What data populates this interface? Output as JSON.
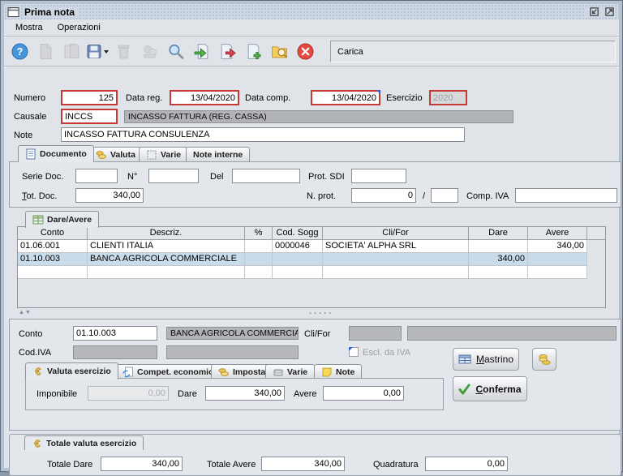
{
  "window": {
    "title": "Prima nota",
    "menu_items": [
      "Mostra",
      "Operazioni"
    ],
    "status_text": "Carica"
  },
  "toolbar_icons": [
    {
      "name": "help-icon",
      "disabled": false
    },
    {
      "name": "edit-icon",
      "disabled": true
    },
    {
      "name": "copy-icon",
      "disabled": true
    },
    {
      "name": "save-icon",
      "disabled": false
    },
    {
      "name": "delete-icon",
      "disabled": true
    },
    {
      "name": "stamp-icon",
      "disabled": true
    },
    {
      "name": "search-icon",
      "disabled": false
    },
    {
      "name": "go-icon",
      "disabled": false
    },
    {
      "name": "export-icon",
      "disabled": false
    },
    {
      "name": "new-document-icon",
      "disabled": false
    },
    {
      "name": "browse-icon",
      "disabled": false
    },
    {
      "name": "close-icon",
      "disabled": false
    }
  ],
  "header_fields": {
    "numero": {
      "label": "Numero",
      "value": "125"
    },
    "data_reg": {
      "label": "Data reg.",
      "value": "13/04/2020"
    },
    "data_comp": {
      "label": "Data comp.",
      "value": "13/04/2020"
    },
    "esercizio": {
      "label": "Esercizio",
      "value": "2020",
      "disabled": true
    },
    "causale": {
      "label": "Causale",
      "value": "INCCS",
      "description": "INCASSO FATTURA (REG. CASSA)"
    },
    "note": {
      "label": "Note",
      "value": "INCASSO FATTURA CONSULENZA"
    }
  },
  "doc_tabs": [
    {
      "label": "Documento",
      "icon": "document-icon",
      "active": true
    },
    {
      "label": "Valuta",
      "icon": "coins-icon",
      "active": false
    },
    {
      "label": "Varie",
      "icon": "clipboard-icon",
      "active": false
    },
    {
      "label": "Note interne",
      "icon": null,
      "active": false
    }
  ],
  "documento": {
    "serie_doc": {
      "label": "Serie Doc.",
      "value": ""
    },
    "numero_doc": {
      "label": "N°",
      "value": ""
    },
    "del": {
      "label": "Del",
      "value": ""
    },
    "prot_sdi": {
      "label": "Prot. SDI",
      "value": ""
    },
    "tot_doc": {
      "label": "Tot. Doc.",
      "value": "340,00"
    },
    "n_prot": {
      "label": "N. prot.",
      "value": "0",
      "separator": "/",
      "value2": ""
    },
    "comp_iva": {
      "label": "Comp. IVA",
      "value": ""
    }
  },
  "grid": {
    "tab_label": "Dare/Avere",
    "columns": [
      "Conto",
      "Descriz.",
      "%",
      "Cod. Sogg",
      "Cli/For",
      "Dare",
      "Avere"
    ],
    "rows": [
      {
        "conto": "01.06.001",
        "descriz": "CLIENTI ITALIA",
        "percent": "",
        "cod_sogg": "0000046",
        "cli_for": "SOCIETA' ALPHA SRL",
        "dare": "",
        "avere": "340,00"
      },
      {
        "conto": "01.10.003",
        "descriz": "BANCA AGRICOLA COMMERCIALE",
        "percent": "",
        "cod_sogg": "",
        "cli_for": "",
        "dare": "340,00",
        "avere": ""
      }
    ],
    "selected_row_index": 1
  },
  "detail": {
    "conto": {
      "label": "Conto",
      "value": "01.10.003",
      "description": "BANCA AGRICOLA COMMERCIALE"
    },
    "cli_for": {
      "label": "Cli/For",
      "value": "",
      "description": ""
    },
    "cod_iva": {
      "label": "Cod.IVA",
      "value": "",
      "description": ""
    },
    "escl_iva": {
      "label": "Escl. da IVA",
      "checked": false,
      "disabled": true
    },
    "mastrino_button": "Mastrino",
    "coins_button": "valuta",
    "conferma_button": "Conferma",
    "tabs": [
      {
        "label": "Valuta esercizio",
        "icon": "euro-icon",
        "active": true
      },
      {
        "label": "Compet. economica",
        "icon": "document-refresh-icon",
        "active": false
      },
      {
        "label": "Imposta",
        "icon": "coins-icon",
        "active": false
      },
      {
        "label": "Varie",
        "icon": "calculator-icon",
        "active": false
      },
      {
        "label": "Note",
        "icon": "note-icon",
        "active": false
      }
    ],
    "valuta_esercizio": {
      "imponibile": {
        "label": "Imponibile",
        "value": "0,00",
        "disabled": true
      },
      "dare": {
        "label": "Dare",
        "value": "340,00"
      },
      "avere": {
        "label": "Avere",
        "value": "0,00"
      }
    }
  },
  "totals": {
    "tab_label": "Totale valuta esercizio",
    "totale_dare": {
      "label": "Totale Dare",
      "value": "340,00"
    },
    "totale_avere": {
      "label": "Totale Avere",
      "value": "340,00"
    },
    "quadratura": {
      "label": "Quadratura",
      "value": "0,00"
    }
  },
  "colors": {
    "required_border": "#c43a34",
    "readonly_bg": "#b2b3b6",
    "selected_row_bg": "#c9dcec",
    "titlebar_bg": "#ced8e4",
    "panel_bg": "#e0e3e7"
  }
}
